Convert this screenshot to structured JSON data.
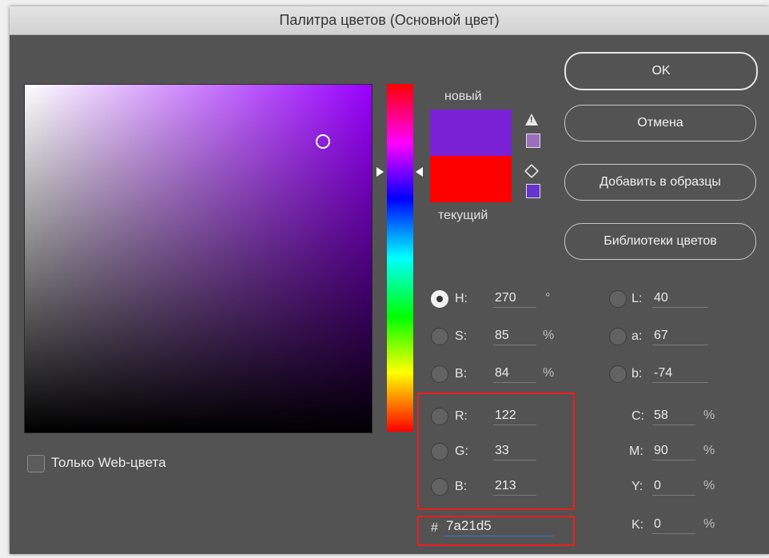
{
  "window": {
    "title": "Палитра цветов (Основной цвет)"
  },
  "swatch": {
    "new_label": "новый",
    "current_label": "текущий",
    "new_color": "#7a21d5",
    "current_color": "#ff0000"
  },
  "buttons": {
    "ok": "OK",
    "cancel": "Отмена",
    "add_swatch": "Добавить в образцы",
    "libraries": "Библиотеки цветов"
  },
  "web_only": {
    "label": "Только Web-цвета",
    "checked": false
  },
  "hsb": {
    "h": {
      "label": "H:",
      "value": "270",
      "unit": "°"
    },
    "s": {
      "label": "S:",
      "value": "85",
      "unit": "%"
    },
    "b": {
      "label": "B:",
      "value": "84",
      "unit": "%"
    }
  },
  "rgb": {
    "r": {
      "label": "R:",
      "value": "122"
    },
    "g": {
      "label": "G:",
      "value": "33"
    },
    "b": {
      "label": "B:",
      "value": "213"
    }
  },
  "lab": {
    "l": {
      "label": "L:",
      "value": "40"
    },
    "a": {
      "label": "a:",
      "value": "67"
    },
    "b": {
      "label": "b:",
      "value": "-74"
    }
  },
  "cmyk": {
    "c": {
      "label": "C:",
      "value": "58",
      "unit": "%"
    },
    "m": {
      "label": "M:",
      "value": "90",
      "unit": "%"
    },
    "y": {
      "label": "Y:",
      "value": "0",
      "unit": "%"
    },
    "k": {
      "label": "K:",
      "value": "0",
      "unit": "%"
    }
  },
  "hex": {
    "prefix": "#",
    "value": "7a21d5"
  },
  "icons": {
    "warning": "gamut-warning-icon",
    "cube": "web-safe-cube-icon"
  },
  "gamut_swatch_color": "#9b6fc0",
  "websafe_swatch_color": "#6633cc"
}
